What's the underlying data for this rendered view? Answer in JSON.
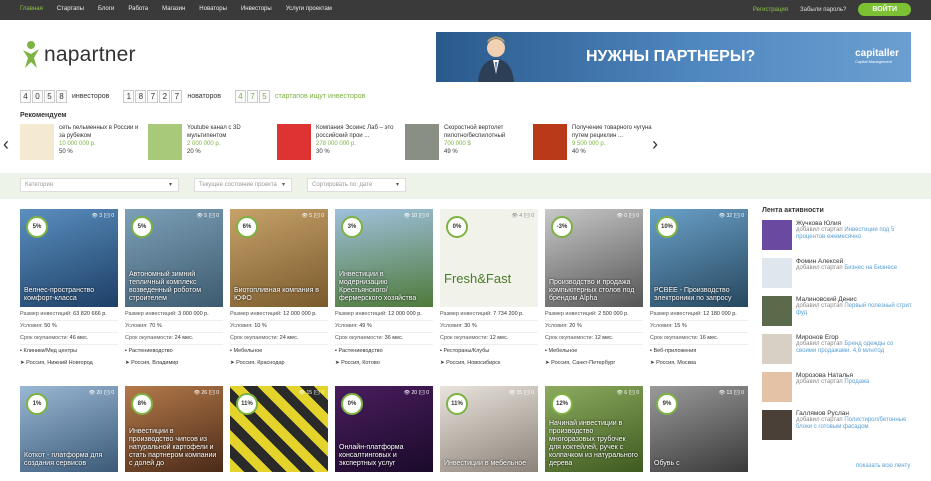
{
  "nav": {
    "items": [
      "Главная",
      "Стартапы",
      "Блоги",
      "Работа",
      "Магазин",
      "Новаторы",
      "Инвесторы",
      "Услуги проектам"
    ],
    "register": "Регистрация",
    "forgot": "Забыли пароль?",
    "login": "ВОЙТИ"
  },
  "logo": {
    "text": "napartner"
  },
  "banner": {
    "text": "НУЖНЫ ПАРТНЕРЫ?",
    "brand": "capitaller",
    "brand_sub": "Capital Management"
  },
  "counters": {
    "investors_digits": [
      "4",
      "0",
      "5",
      "8"
    ],
    "investors_label": "инвесторов",
    "innovators_digits": [
      "1",
      "8",
      "7",
      "2",
      "7"
    ],
    "innovators_label": "новаторов",
    "startups_digits": [
      "4",
      "7",
      "5"
    ],
    "startups_label": "стартапов ищут инвесторов"
  },
  "recommended": {
    "title": "Рекомендуем",
    "items": [
      {
        "title": "сеть пельменных в России и за рубежом",
        "amount": "10 000 000 р.",
        "pct": "50 %"
      },
      {
        "title": "Youtube канал с 3D мультипентом",
        "amount": "2 000 000 р.",
        "pct": "20 %"
      },
      {
        "title": "Компания Эсоинс Лаб – это российский прои ...",
        "amount": "278 000 000 р.",
        "pct": "30 %"
      },
      {
        "title": "Скоростной вертолет пилотно/беспилотный",
        "amount": "700 000 $",
        "pct": "49 %"
      },
      {
        "title": "Получение товарного чугуна путем рециклин ...",
        "amount": "9 500 000 р.",
        "pct": "40 %"
      }
    ]
  },
  "filters": {
    "category": "Категория",
    "stage": "Текущее состояние проекта",
    "sort": "Сортировать по: дате"
  },
  "cards_row1": [
    {
      "pct": "5%",
      "views": "3",
      "comments": "0",
      "title": "Велнес-пространство комфорт-класса",
      "size": "63 820 666 р.",
      "terms": "50 %",
      "payback": "46 мес.",
      "category": "Клиники/Мед центры",
      "location": "Россия, Нижний Новгород"
    },
    {
      "pct": "5%",
      "views": "5",
      "comments": "0",
      "title": "Автономный зимний тепличный комплекс возведенный роботом строителем",
      "size": "3 000 000 р.",
      "terms": "70 %",
      "payback": "24 мес.",
      "category": "Растениеводство",
      "location": "Россия, Владимир"
    },
    {
      "pct": "6%",
      "views": "5",
      "comments": "0",
      "title": "Биотопливная компания в ЮФО",
      "size": "12 000 000 р.",
      "terms": "10 %",
      "payback": "24 мес.",
      "category": "Мебельное",
      "location": "Россия, Краснодар"
    },
    {
      "pct": "3%",
      "views": "10",
      "comments": "0",
      "title": "Инвестиции в модернизацию Крестьянского/фермерского хозяйства",
      "size": "12 000 000 р.",
      "terms": "49 %",
      "payback": "36 мес.",
      "category": "Растениеводство",
      "location": "Россия, Котово"
    },
    {
      "pct": "0%",
      "views": "4",
      "comments": "0",
      "title": "Fresh&Fast",
      "size": "7 734 200 р.",
      "terms": "30 %",
      "payback": "12 мес.",
      "category": "Рестораны/Клубы",
      "location": "Россия, Новосибирск"
    },
    {
      "pct": "-3%",
      "views": "0",
      "comments": "0",
      "title": "Производство и продажа компьютерных столов под брендом Alpha",
      "size": "2 500 000 р.",
      "terms": "20 %",
      "payback": "12 мес.",
      "category": "Мебельное",
      "location": "Россия, Санкт-Петербург"
    },
    {
      "pct": "10%",
      "views": "32",
      "comments": "0",
      "title": "PCBEE - Производство электроники по запросу",
      "size": "12 180 000 р.",
      "terms": "15 %",
      "payback": "16 мес.",
      "category": "Веб-приложения",
      "location": "Россия, Москва"
    }
  ],
  "cards_row2": [
    {
      "pct": "1%",
      "views": "20",
      "comments": "0",
      "title": "Коткот - платформа для создания сервисов"
    },
    {
      "pct": "8%",
      "views": "26",
      "comments": "0",
      "title": "Инвестиции в производство чипсов из натуральной картофели и стать партнером компании с долей до"
    },
    {
      "pct": "11%",
      "views": "15",
      "comments": "0",
      "title": ""
    },
    {
      "pct": "0%",
      "views": "20",
      "comments": "0",
      "title": "Онлайн-платформа консалтинговых и экспертных услуг"
    },
    {
      "pct": "11%",
      "views": "15",
      "comments": "0",
      "title": "Инвестиции в мебельное"
    },
    {
      "pct": "12%",
      "views": "6",
      "comments": "0",
      "title": "Начинай инвестиции в производство многоразовых трубочек для коктейлей, ручек с колпачком из натурального дерева"
    },
    {
      "pct": "9%",
      "views": "13",
      "comments": "0",
      "title": "Обувь с"
    }
  ],
  "card_labels": {
    "size": "Размер инвестиций:",
    "terms": "Условия:",
    "payback": "Срок окупаемости:"
  },
  "activity": {
    "title": "Лента активности",
    "more": "показать всю ленту",
    "items": [
      {
        "name": "Жучкова Юлия",
        "action": "добавил стартап",
        "link": "Инвестиции под 5 процентов ежемесячно"
      },
      {
        "name": "Фомин Алексей",
        "action": "добавил стартап",
        "link": "Бизнес на Бизнесе"
      },
      {
        "name": "Малиновский Денис",
        "action": "добавил стартап",
        "link": "Первый полезный стрит фуд"
      },
      {
        "name": "Миронов Егор",
        "action": "добавил стартап",
        "link": "Бренд одежды со своими продажами. 4,6 млн/год"
      },
      {
        "name": "Морозова Наталья",
        "action": "добавил стартап",
        "link": "Продажа"
      },
      {
        "name": "Галлямов Руслан",
        "action": "добавил стартап",
        "link": "Полистирол/бетонные блоки с готовым фасадом"
      }
    ]
  },
  "colors": {
    "accent": "#7cb342",
    "topbar": "#3a3a3a",
    "filterbar": "#eef3ea",
    "link": "#5a9fd4"
  }
}
